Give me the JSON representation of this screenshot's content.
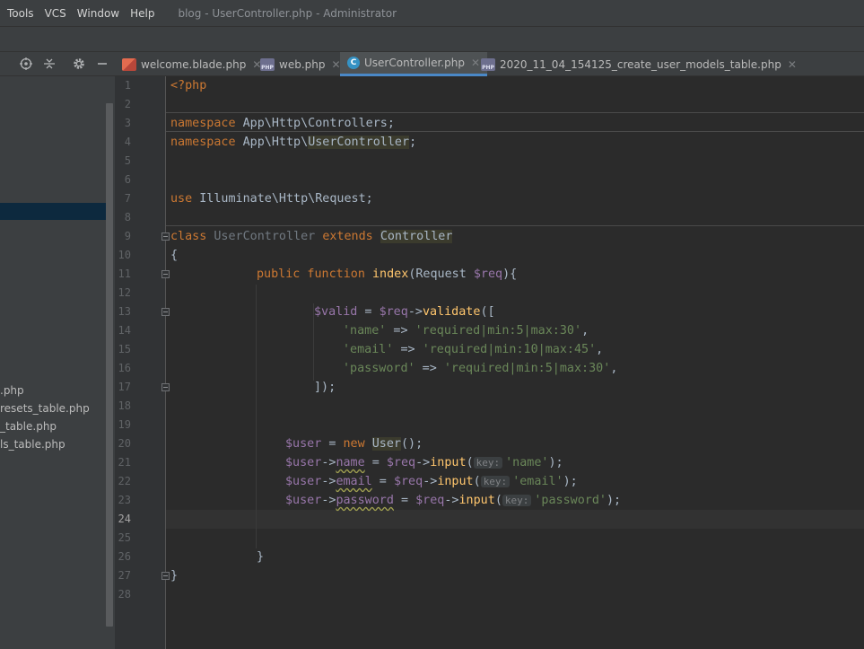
{
  "menubar": {
    "items": [
      "Tools",
      "VCS",
      "Window",
      "Help"
    ],
    "title": "blog - UserController.php - Administrator"
  },
  "project_toolbar": {
    "icons": [
      "locate-icon",
      "collapse-icon",
      "gear-icon",
      "minimize-icon"
    ]
  },
  "tabs": [
    {
      "label": "welcome.blade.php",
      "icon": "blade-file-icon",
      "active": false
    },
    {
      "label": "web.php",
      "icon": "php-file-icon",
      "active": false
    },
    {
      "label": "UserController.php",
      "icon": "class-icon",
      "active": true
    },
    {
      "label": "2020_11_04_154125_create_user_models_table.php",
      "icon": "php-file-icon",
      "active": false
    }
  ],
  "sidebar": {
    "files": [
      ".php",
      "resets_table.php",
      "_table.php",
      "ls_table.php"
    ]
  },
  "editor": {
    "line_numbers": [
      "1",
      "2",
      "3",
      "4",
      "5",
      "6",
      "7",
      "8",
      "9",
      "10",
      "11",
      "12",
      "13",
      "14",
      "15",
      "16",
      "17",
      "18",
      "19",
      "20",
      "21",
      "22",
      "23",
      "24",
      "25",
      "26",
      "27",
      "28"
    ],
    "lines": {
      "l1": "<?php",
      "l3_kw": "namespace",
      "l3_rest": " App\\Http\\Controllers;",
      "l4_kw": "namespace",
      "l4_ns": " App\\Http\\",
      "l4_hl": "UserController",
      "l4_end": ";",
      "l7_kw": "use",
      "l7_rest": " Illuminate\\Http\\Request;",
      "l9_kw": "class",
      "l9_name": " UserController ",
      "l9_ext": "extends",
      "l9_sp": " ",
      "l9_hl": "Controller",
      "l10": "{",
      "l11_kw": "public function",
      "l11_sp": " ",
      "l11_fn": "index",
      "l11_p1": "(Request ",
      "l11_var": "$req",
      "l11_p2": "){",
      "l13_var": "$valid",
      "l13_eq": " = ",
      "l13_var2": "$req",
      "l13_arrow": "->",
      "l13_fn": "validate",
      "l13_end": "([",
      "l14_key": "'name'",
      "l14_op": " => ",
      "l14_val": "'required|min:5|max:30'",
      "l14_end": ",",
      "l15_key": "'email'",
      "l15_op": " => ",
      "l15_val": "'required|min:10|max:45'",
      "l15_end": ",",
      "l16_key": "'password'",
      "l16_op": " => ",
      "l16_val": "'required|min:5|max:30'",
      "l16_end": ",",
      "l17": "]);",
      "l20_var": "$user",
      "l20_eq": " = ",
      "l20_new": "new",
      "l20_sp": " ",
      "l20_cls": "User",
      "l20_end": "();",
      "l21_var": "$user",
      "l21_arrow": "->",
      "l21_prop": "name",
      "l21_eq": " = ",
      "l21_var2": "$req",
      "l21_arrow2": "->",
      "l21_fn": "input",
      "l21_open": "(",
      "l21_hint": "key:",
      "l21_str": "'name'",
      "l21_end": ");",
      "l22_var": "$user",
      "l22_arrow": "->",
      "l22_prop": "email",
      "l22_eq": " = ",
      "l22_var2": "$req",
      "l22_arrow2": "->",
      "l22_fn": "input",
      "l22_open": "(",
      "l22_hint": "key:",
      "l22_str": "'email'",
      "l22_end": ");",
      "l23_var": "$user",
      "l23_arrow": "->",
      "l23_prop": "password",
      "l23_eq": " = ",
      "l23_var2": "$req",
      "l23_arrow2": "->",
      "l23_fn": "input",
      "l23_open": "(",
      "l23_hint": "key:",
      "l23_str": "'password'",
      "l23_end": ");",
      "l26": "}",
      "l27": "}"
    }
  },
  "colors": {
    "keyword": "#cc7832",
    "variable": "#9876aa",
    "string": "#6a8759",
    "function": "#ffc66d",
    "text": "#a9b7c6",
    "active_tab_underline": "#4a88c7"
  }
}
